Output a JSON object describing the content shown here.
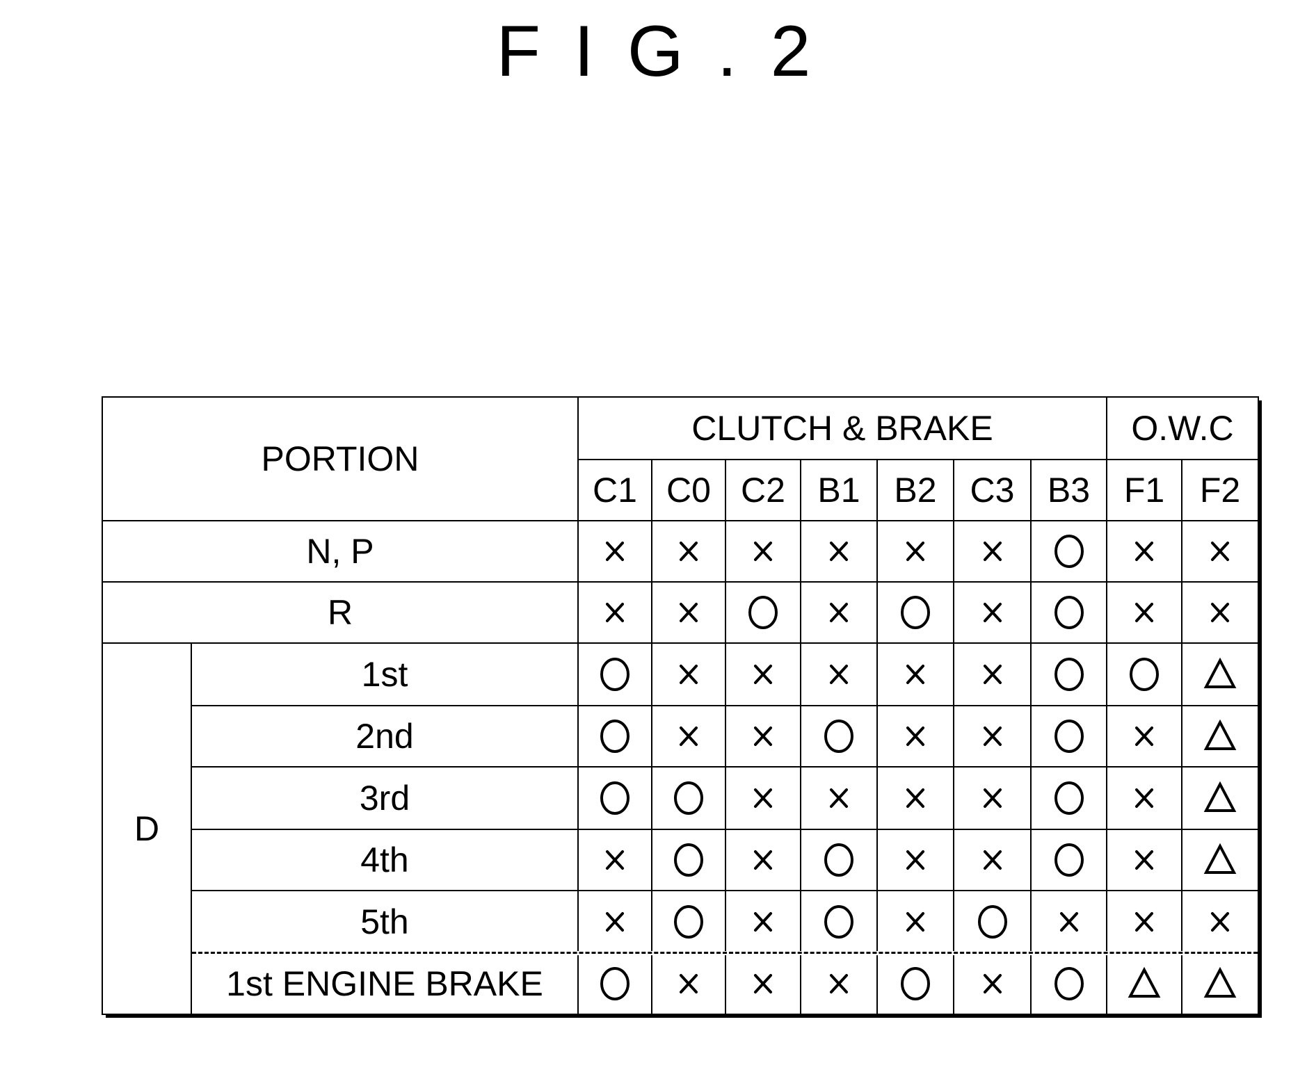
{
  "figure": {
    "title": "FIG.2"
  },
  "table": {
    "portion_header": "PORTION",
    "group_headers": [
      {
        "label": "CLUTCH & BRAKE",
        "span": 7
      },
      {
        "label": "O.W.C",
        "span": 2
      }
    ],
    "columns": [
      "C1",
      "C0",
      "C2",
      "B1",
      "B2",
      "C3",
      "B3",
      "F1",
      "F2"
    ],
    "rows": [
      {
        "group": "",
        "label": "N, P",
        "values": [
          "x",
          "x",
          "x",
          "x",
          "x",
          "x",
          "o",
          "x",
          "x"
        ]
      },
      {
        "group": "",
        "label": "R",
        "values": [
          "x",
          "x",
          "o",
          "x",
          "o",
          "x",
          "o",
          "x",
          "x"
        ]
      },
      {
        "group": "D",
        "label": "1st",
        "values": [
          "o",
          "x",
          "x",
          "x",
          "x",
          "x",
          "o",
          "o",
          "t"
        ]
      },
      {
        "group": "D",
        "label": "2nd",
        "values": [
          "o",
          "x",
          "x",
          "o",
          "x",
          "x",
          "o",
          "x",
          "t"
        ]
      },
      {
        "group": "D",
        "label": "3rd",
        "values": [
          "o",
          "o",
          "x",
          "x",
          "x",
          "x",
          "o",
          "x",
          "t"
        ]
      },
      {
        "group": "D",
        "label": "4th",
        "values": [
          "x",
          "o",
          "x",
          "o",
          "x",
          "x",
          "o",
          "x",
          "t"
        ]
      },
      {
        "group": "D",
        "label": "5th",
        "values": [
          "x",
          "o",
          "x",
          "o",
          "x",
          "o",
          "x",
          "x",
          "x"
        ]
      },
      {
        "group": "D",
        "label": "1st ENGINE BRAKE",
        "values": [
          "o",
          "x",
          "x",
          "x",
          "o",
          "x",
          "o",
          "t",
          "t"
        ]
      }
    ],
    "d_group_label": "D",
    "legend_symbols": {
      "o": "circle-icon (engaged)",
      "x": "cross-icon (released)",
      "t": "triangle-icon (engaged when driving)"
    }
  }
}
